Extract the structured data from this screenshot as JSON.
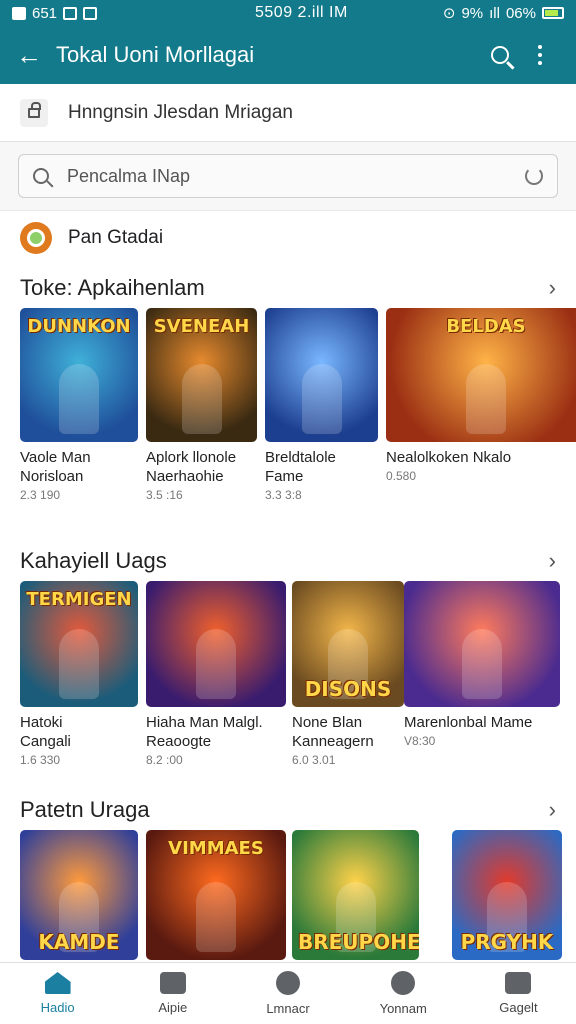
{
  "status": {
    "left_text": "651",
    "center_text": "5509 2.ill IM",
    "right_pct": "9%",
    "battery": "06%"
  },
  "appbar": {
    "title": "Tokal Uoni Morllagai"
  },
  "info": {
    "text": "Hnngnsin Jlesdan Mriagan"
  },
  "search": {
    "placeholder": "Pencalma INap"
  },
  "pan": {
    "label": "Pan Gtadai"
  },
  "sections": [
    {
      "title": "Toke: Apkaihenlam",
      "items": [
        {
          "line1": "Vaole Man",
          "line2": "Norisloan",
          "meta": "2.3 190",
          "logo": "DUNNKON",
          "logo_pos": "top",
          "c1": "#1f4f9a",
          "c2": "#3fb0d8"
        },
        {
          "line1": "Aplork llonole",
          "line2": "Naerhaohie",
          "meta": "3.5 :16",
          "logo": "SVENEAH",
          "logo_pos": "top",
          "c1": "#3a2a12",
          "c2": "#e68a2e"
        },
        {
          "line1": "Breldtalole",
          "line2": "Fame",
          "meta": "3.3 3:8",
          "logo": "",
          "logo_pos": "top",
          "c1": "#1d3f8f",
          "c2": "#79b7ff"
        },
        {
          "line1": "Nealolkoken Nkalo",
          "line2": "",
          "meta": "0.580",
          "logo": "BELDAS",
          "logo_pos": "top",
          "c1": "#9a2f13",
          "c2": "#ffb347"
        }
      ]
    },
    {
      "title": "Kahayiell Uags",
      "items": [
        {
          "line1": "Hatoki",
          "line2": "Cangali",
          "meta": "1.6 330",
          "logo": "TERMIGEN",
          "logo_pos": "top",
          "c1": "#1a5c7a",
          "c2": "#e35a3c"
        },
        {
          "line1": "Hiaha Man Malgl.",
          "line2": "Reaoogte",
          "meta": "8.2 :00",
          "logo": "",
          "logo_pos": "top",
          "c1": "#3a1c6e",
          "c2": "#f0602c"
        },
        {
          "line1": "None Blan",
          "line2": "Kanneagern",
          "meta": "6.0 3.01",
          "logo": "DISONS",
          "logo_pos": "bottom",
          "c1": "#6a4a20",
          "c2": "#f3b64a"
        },
        {
          "line1": "Marenlonbal Mame",
          "line2": "",
          "meta": "V8:30",
          "logo": "",
          "logo_pos": "top",
          "c1": "#4b2b8f",
          "c2": "#ff7b5c"
        }
      ]
    },
    {
      "title": "Patetn Uraga",
      "items": [
        {
          "line1": "",
          "line2": "",
          "meta": "",
          "logo": "KAMDE",
          "logo_pos": "bottom",
          "c1": "#2f3f9a",
          "c2": "#ff9a3c"
        },
        {
          "line1": "",
          "line2": "",
          "meta": "",
          "logo": "VIMMAES",
          "logo_pos": "top",
          "c1": "#5a1a10",
          "c2": "#ff6a1f"
        },
        {
          "line1": "",
          "line2": "",
          "meta": "",
          "logo": "BREUPOHES",
          "logo_pos": "bottom",
          "c1": "#2c7a3a",
          "c2": "#ffd24a"
        },
        {
          "line1": "",
          "line2": "",
          "meta": "",
          "logo": "PRGYHK",
          "logo_pos": "bottom",
          "c1": "#2a6ac4",
          "c2": "#e33a2a"
        }
      ]
    }
  ],
  "nav": [
    {
      "label": "Hadio",
      "active": true
    },
    {
      "label": "Aipie",
      "active": false
    },
    {
      "label": "Lmnacr",
      "active": false
    },
    {
      "label": "Yonnam",
      "active": false
    },
    {
      "label": "Gagelt",
      "active": false
    }
  ]
}
